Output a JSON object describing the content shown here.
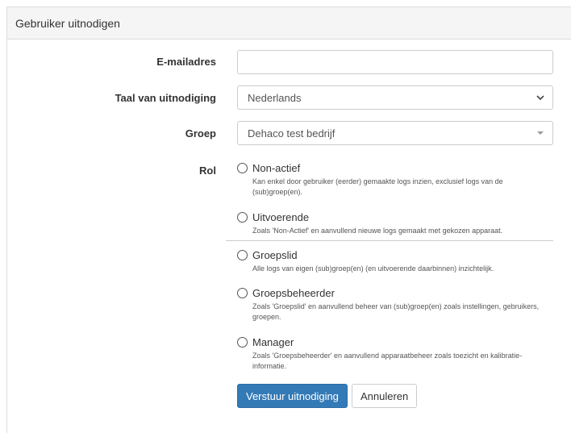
{
  "header": {
    "title": "Gebruiker uitnodigen"
  },
  "form": {
    "email": {
      "label": "E-mailadres",
      "value": "",
      "placeholder": ""
    },
    "language": {
      "label": "Taal van uitnodiging",
      "value": "Nederlands"
    },
    "group": {
      "label": "Groep",
      "value": "Dehaco test bedrijf"
    },
    "role": {
      "label": "Rol",
      "options": [
        {
          "label": "Non-actief",
          "description": "Kan enkel door gebruiker (eerder) gemaakte logs inzien, exclusief logs van de (sub)groep(en)."
        },
        {
          "label": "Uitvoerende",
          "description": "Zoals 'Non-Actief' en aanvullend nieuwe logs gemaakt met gekozen apparaat."
        },
        {
          "label": "Groepslid",
          "description": "Alle logs van eigen (sub)groep(en) (en uitvoerende daarbinnen) inzichtelijk."
        },
        {
          "label": "Groepsbeheerder",
          "description": "Zoals 'Groepslid' en aanvullend beheer van (sub)groep(en) zoals instellingen, gebruikers, groepen."
        },
        {
          "label": "Manager",
          "description": "Zoals 'Groepsbeheerder' en aanvullend apparaatbeheer zoals toezicht en kalibratie-informatie."
        }
      ]
    }
  },
  "buttons": {
    "submit": "Verstuur uitnodiging",
    "cancel": "Annuleren"
  },
  "icons": {
    "language_select": "chevron-down-icon",
    "group_select": "caret-down-icon"
  },
  "colors": {
    "primary": "#337ab7",
    "header_bg": "#f5f5f5"
  }
}
